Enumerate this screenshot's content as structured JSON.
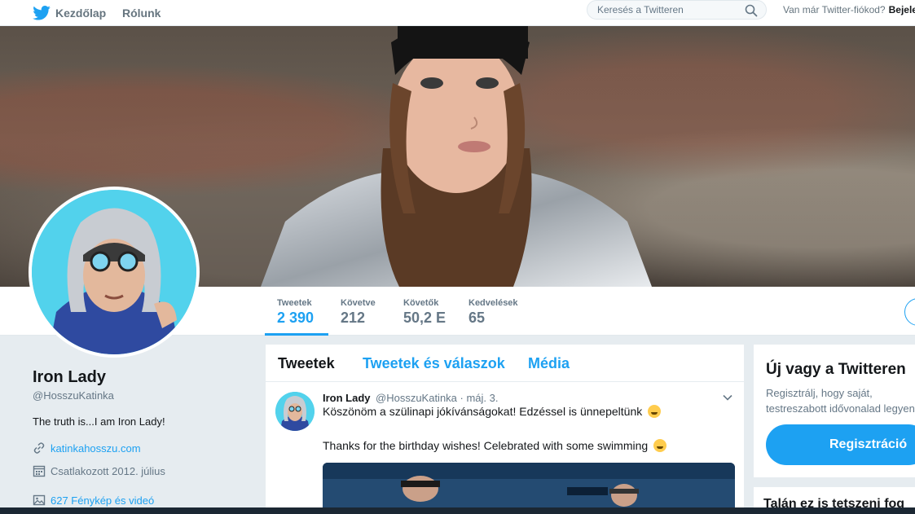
{
  "nav": {
    "home_label": "Kezdőlap",
    "about_label": "Rólunk",
    "search_placeholder": "Keresés a Twitteren",
    "login_prompt": "Van már Twitter-fiókod?",
    "login_link": "Bejele"
  },
  "profile": {
    "name": "Iron Lady",
    "handle": "@HosszuKatinka",
    "bio": "The truth is...I am Iron Lady!",
    "website": "katinkahosszu.com",
    "joined": "Csatlakozott 2012. július",
    "media": "627 Fénykép és videó"
  },
  "stats": [
    {
      "label": "Tweetek",
      "value": "2 390"
    },
    {
      "label": "Követve",
      "value": "212"
    },
    {
      "label": "Követők",
      "value": "50,2 E"
    },
    {
      "label": "Kedvelések",
      "value": "65"
    }
  ],
  "timeline": {
    "tabs": [
      "Tweetek",
      "Tweetek és válaszok",
      "Média"
    ],
    "tweet": {
      "author": "Iron Lady",
      "meta": "@HosszuKatinka · máj. 3.",
      "text_hu": "Köszönöm a szülinapi jókívánságokat! Edzéssel is ünnepeltünk",
      "text_en": "Thanks for the birthday wishes! Celebrated with some swimming"
    }
  },
  "sidebar": {
    "signup_title": "Új vagy a Twitteren",
    "signup_desc": "Regisztrálj, hogy saját, testreszabott idővonalad legyen!",
    "signup_button": "Regisztráció",
    "suggest_title": "Talán ez is tetszeni fog"
  },
  "colors": {
    "accent": "#1da1f2",
    "background": "#e6ecf0",
    "muted_text": "#657786"
  },
  "icons": [
    "twitter-bird-icon",
    "search-icon",
    "link-icon",
    "calendar-icon",
    "photo-icon",
    "chevron-down-icon",
    "hugging-face-emoji"
  ]
}
